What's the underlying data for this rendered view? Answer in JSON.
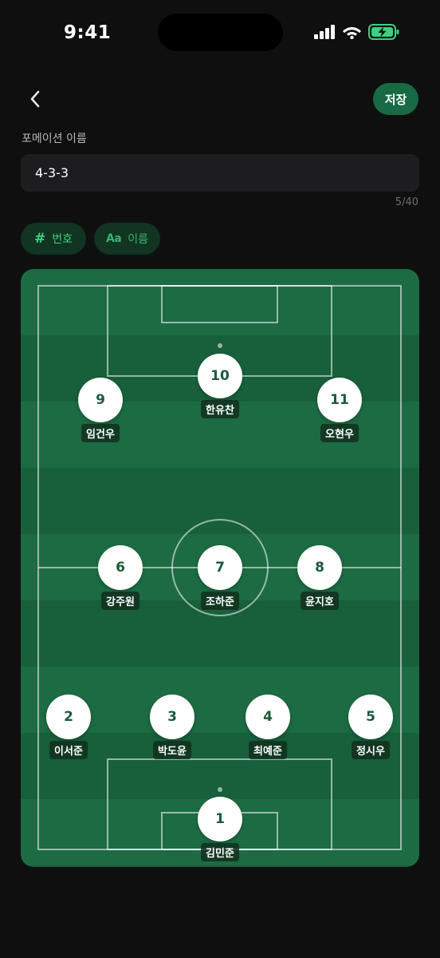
{
  "status_bar": {
    "time": "9:41",
    "icons": [
      "signal-icon",
      "wifi-icon",
      "battery-charging-icon"
    ],
    "battery_color": "#3ed07f"
  },
  "header": {
    "back_icon": "chevron-left-icon",
    "save_label": "저장"
  },
  "formation": {
    "label": "포메이션 이름",
    "value": "4-3-3",
    "char_count": "5/40"
  },
  "modes": [
    {
      "icon": "#",
      "label": "번호"
    },
    {
      "icon": "Aa",
      "label": "이름"
    }
  ],
  "colors": {
    "accent": "#176a43",
    "pitch_light": "#1c6b43",
    "pitch_dark": "#185f3b",
    "chip_bg": "#123422",
    "chip_text": "#3ed07f"
  },
  "players": [
    {
      "number": "10",
      "name": "한유찬"
    },
    {
      "number": "9",
      "name": "임건우"
    },
    {
      "number": "11",
      "name": "오현우"
    },
    {
      "number": "6",
      "name": "강주원"
    },
    {
      "number": "7",
      "name": "조하준"
    },
    {
      "number": "8",
      "name": "윤지호"
    },
    {
      "number": "2",
      "name": "이서준"
    },
    {
      "number": "3",
      "name": "박도윤"
    },
    {
      "number": "4",
      "name": "최예준"
    },
    {
      "number": "5",
      "name": "정시우"
    },
    {
      "number": "1",
      "name": "김민준"
    }
  ]
}
